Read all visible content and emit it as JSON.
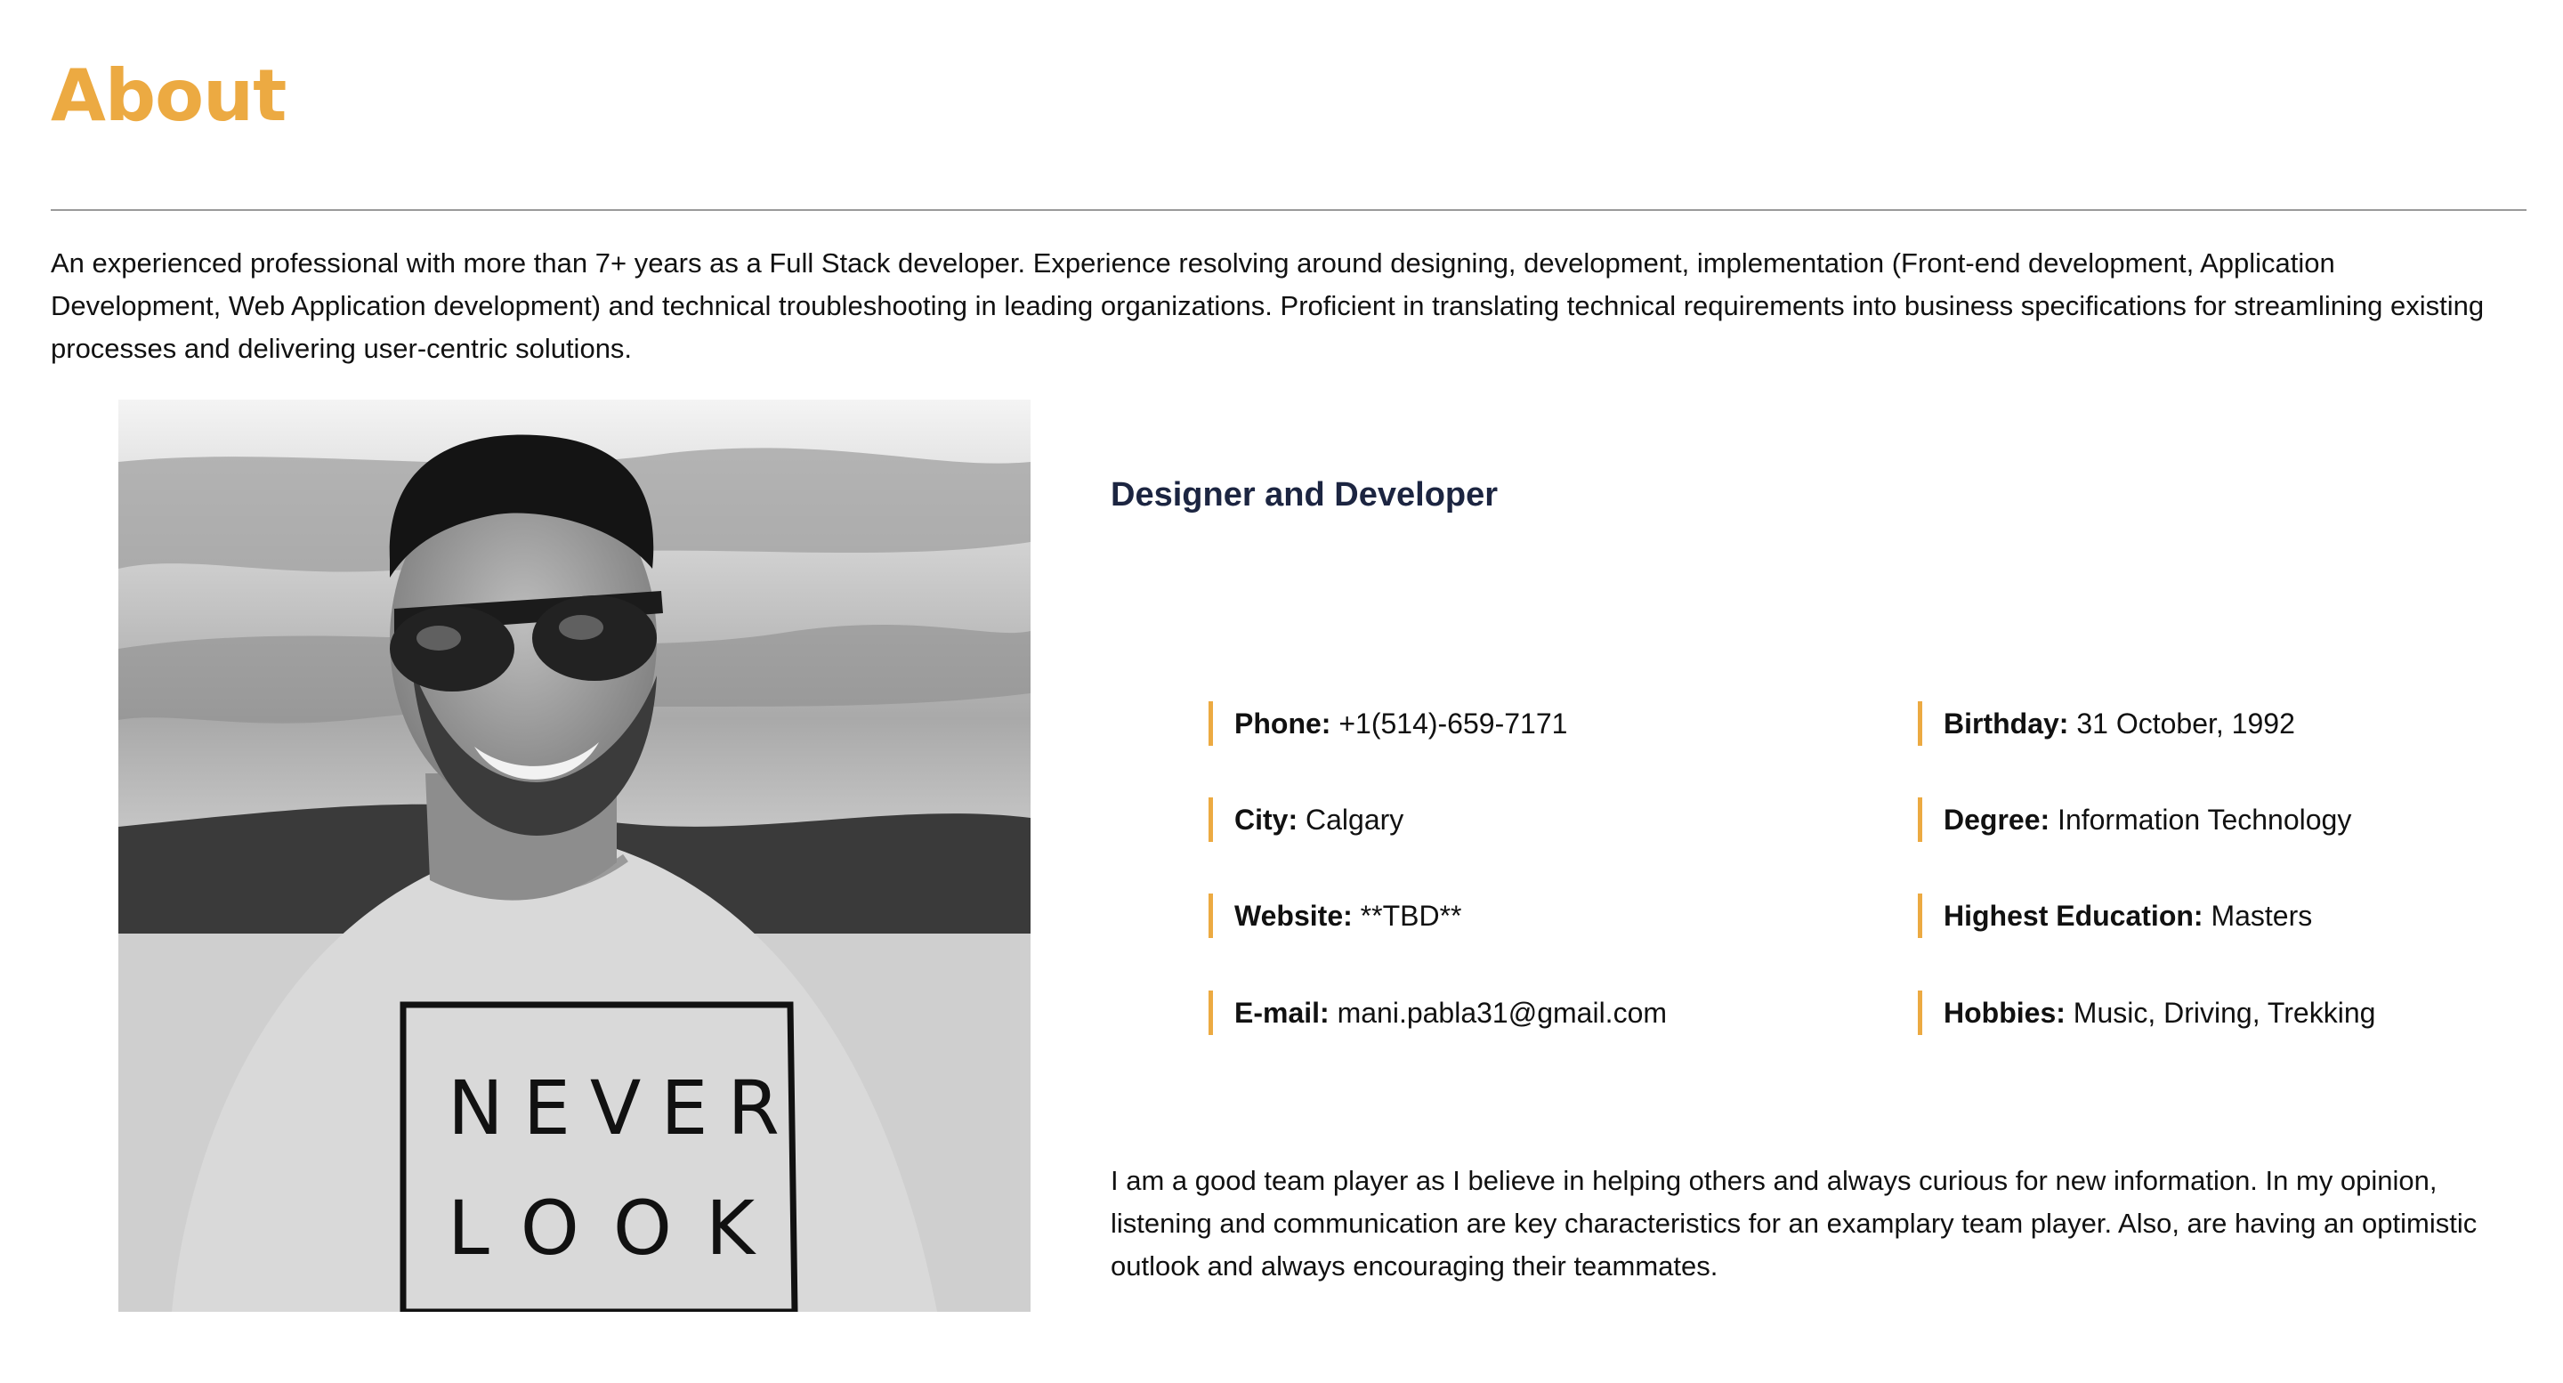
{
  "about": {
    "title": "About",
    "intro": "An experienced professional with more than 7+ years as a Full Stack developer. Experience resolving around designing, development, implementation (Front-end development, Application Development, Web Application development) and technical troubleshooting in leading organizations. Proficient in translating technical requirements into business specifications for streamlining existing processes and delivering user-centric solutions.",
    "role": "Designer and Developer",
    "photo": {
      "shirt_text": [
        "NEVER",
        "LOOK"
      ]
    },
    "info_left": [
      {
        "label": "Phone:",
        "value": "+1(514)-659-7171"
      },
      {
        "label": "City:",
        "value": "Calgary"
      },
      {
        "label": "Website:",
        "value": "**TBD**"
      },
      {
        "label": "E-mail:",
        "value": "mani.pabla31@gmail.com"
      }
    ],
    "info_right": [
      {
        "label": "Birthday:",
        "value": "31 October, 1992"
      },
      {
        "label": "Degree:",
        "value": "Information Technology"
      },
      {
        "label": "Highest Education:",
        "value": "Masters"
      },
      {
        "label": "Hobbies:",
        "value": "Music, Driving, Trekking"
      }
    ],
    "closing": "I am a good team player as I believe in helping others and always curious for new information. In my opinion, listening and communication are key characteristics for an examplary team player. Also, are having an optimistic outlook and always encouraging their teammates."
  },
  "colors": {
    "accent": "#ecaa42",
    "heading_dark": "#1c2541",
    "rule": "#9a9a9a"
  }
}
